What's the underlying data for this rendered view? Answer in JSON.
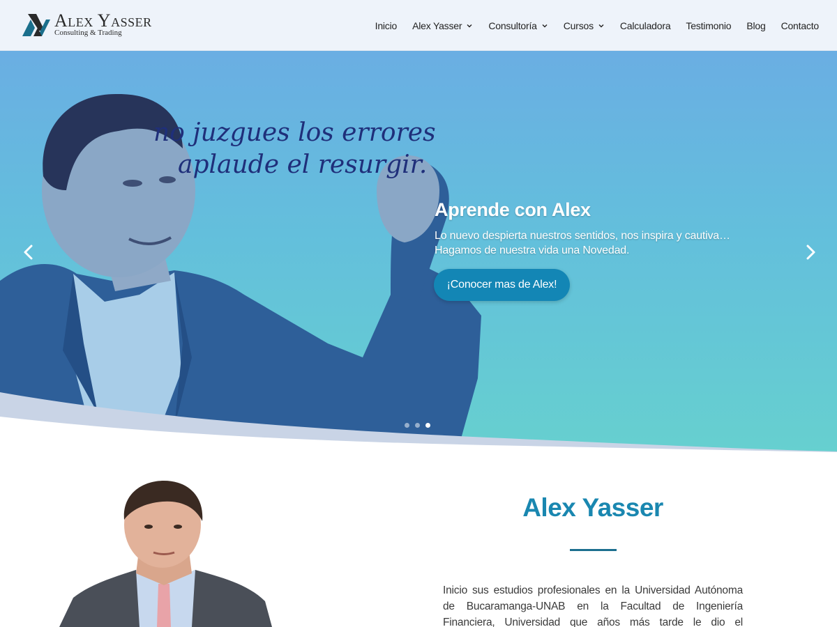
{
  "brand": {
    "name": "Alex Yasser",
    "tagline": "Consulting & Trading",
    "logo_icon": "ay-monogram-icon",
    "accent": "#1386b5"
  },
  "nav": {
    "items": [
      {
        "label": "Inicio",
        "dropdown": false
      },
      {
        "label": "Alex Yasser",
        "dropdown": true
      },
      {
        "label": "Consultoría",
        "dropdown": true
      },
      {
        "label": "Cursos",
        "dropdown": true
      },
      {
        "label": "Calculadora",
        "dropdown": false
      },
      {
        "label": "Testimonio",
        "dropdown": false
      },
      {
        "label": "Blog",
        "dropdown": false
      },
      {
        "label": "Contacto",
        "dropdown": false
      }
    ]
  },
  "hero": {
    "script_line1": "no juzgues los errores",
    "script_line2": "aplaude el resurgir.",
    "title": "Aprende con Alex",
    "subtitle_line1": "Lo nuevo despierta nuestros sentidos, nos inspira y cautiva…",
    "subtitle_line2": "Hagamos de nuestra vida una Novedad.",
    "button_label": "¡Conocer mas de Alex!",
    "prev_icon": "chevron-left-icon",
    "next_icon": "chevron-right-icon",
    "slides_total": 3,
    "active_slide": 3
  },
  "about": {
    "title": "Alex Yasser",
    "text_plain": "Inicio sus estudios profesionales en la Universidad Autónoma de Bucaramanga-UNAB en la Facultad de Ingeniería Financiera, Universidad que años más tarde le dio el reconocimiento como",
    "text_bold": "el"
  }
}
